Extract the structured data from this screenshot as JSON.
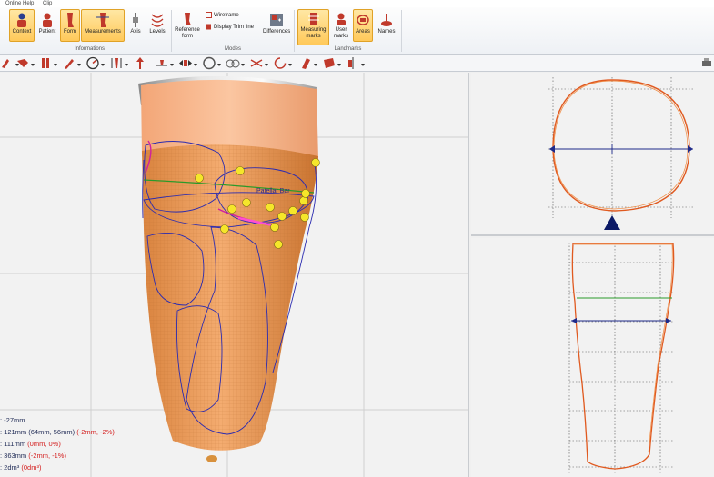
{
  "menubar": {
    "items": [
      "Online Help",
      "Clip"
    ]
  },
  "ribbon": {
    "groups": {
      "informations": "Informations",
      "modes": "Modes",
      "landmarks": "Landmarks"
    },
    "buttons": {
      "context": "Context",
      "patient": "Patient",
      "form": "Form",
      "measurements": "Measurements",
      "axis": "Axis",
      "levels": "Levels",
      "reference_form": "Reference form",
      "wireframe": "Wireframe",
      "display_trim_line": "Display Trim line",
      "differences": "Differences",
      "measuring_marks": "Measuring marks",
      "user_marks": "User marks",
      "areas": "Areas",
      "names": "Names"
    }
  },
  "viewport_main": {
    "label_patellar": "Patellar Bar",
    "measurements": {
      "line1": ": -27mm",
      "line2_main": ": 121mm (64mm, 56mm)",
      "line2_diff": "(-2mm, -2%)",
      "line3_main": ": 111mm",
      "line3_diff": "(0mm, 0%)",
      "line4_main": ": 363mm",
      "line4_diff": "(-2mm, -1%)",
      "line5_main": ": 2dm³",
      "line5_diff": "(0dm³)"
    }
  },
  "colors": {
    "accent": "#ffc95a",
    "socket": "#f0a260",
    "trim": "#2b2bb0",
    "outline": "#e05a20"
  }
}
